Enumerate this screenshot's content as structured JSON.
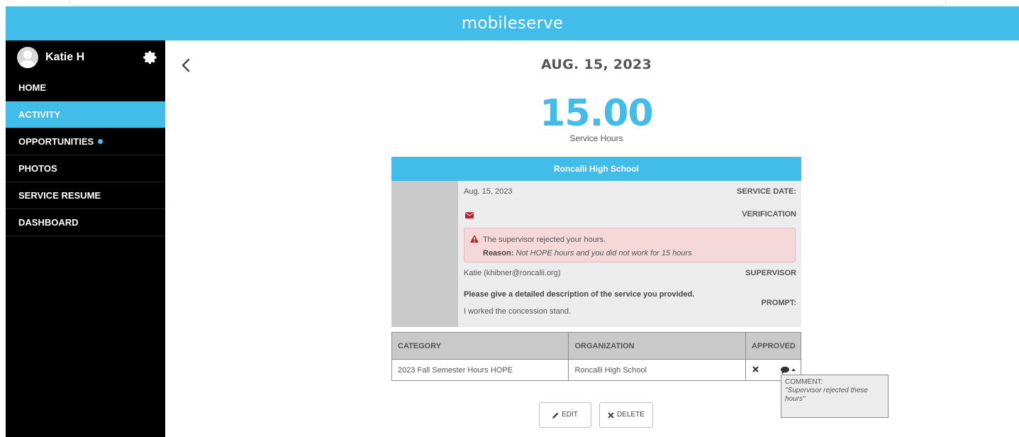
{
  "app": {
    "title": "mobileserve"
  },
  "user": {
    "name": "Katie H"
  },
  "nav": {
    "items": [
      {
        "label": "HOME"
      },
      {
        "label": "ACTIVITY"
      },
      {
        "label": "OPPORTUNITIES"
      },
      {
        "label": "PHOTOS"
      },
      {
        "label": "SERVICE RESUME"
      },
      {
        "label": "DASHBOARD"
      }
    ],
    "active": "ACTIVITY"
  },
  "activity": {
    "date_title": "AUG. 15, 2023",
    "hours": "15.00",
    "hours_label": "Service Hours"
  },
  "card": {
    "organization": "Roncalli High School",
    "service_date_label": "SERVICE DATE:",
    "service_date": "Aug. 15, 2023",
    "verification_label": "VERIFICATION",
    "alert_message": "The supervisor rejected your hours.",
    "alert_reason_label": "Reason:",
    "alert_reason": "Not HOPE hours and you did not work for 15 hours",
    "supervisor_label": "SUPERVISOR",
    "supervisor": "Katie (khibner@roncalli.org)",
    "prompt_label": "PROMPT:",
    "prompt_question": "Please give a detailed description of the service you provided.",
    "prompt_answer": "I worked the concession stand."
  },
  "category_table": {
    "headers": {
      "category": "CATEGORY",
      "organization": "ORGANIZATION",
      "approved": "APPROVED"
    },
    "rows": [
      {
        "category": "2023 Fall Semester Hours HOPE",
        "organization": "Roncalli High School"
      }
    ]
  },
  "comment": {
    "label": "COMMENT:",
    "text": "\"Supervisor rejected these hours\""
  },
  "buttons": {
    "edit": "EDIT",
    "delete": "DELETE"
  },
  "colors": {
    "brand": "#42bce9",
    "sidebar": "#000000",
    "alert_bg": "#f5d8da",
    "alert_icon": "#b3262d"
  },
  "icons": {
    "gear": "gear-icon",
    "back": "chevron-left-icon",
    "mail": "envelope-icon",
    "alert": "warning-icon",
    "reject": "close-icon",
    "comment": "comment-icon",
    "edit": "pencil-icon",
    "delete": "close-icon"
  }
}
